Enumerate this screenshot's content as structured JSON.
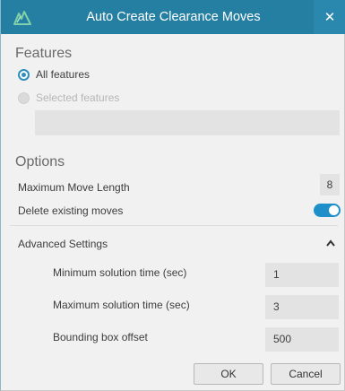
{
  "window": {
    "title": "Auto Create Clearance Moves",
    "app_icon": "dynamics-logo-icon",
    "close_icon": "close-icon",
    "titlebar_color": "#257fa3"
  },
  "features": {
    "title": "Features",
    "all_label": "All features",
    "selected_label": "Selected features",
    "selection": "All features",
    "selection_box_value": ""
  },
  "options": {
    "title": "Options",
    "max_move_length_label": "Maximum Move Length",
    "max_move_length_value": "8",
    "delete_moves_label": "Delete existing moves",
    "delete_moves_on": true,
    "toggle_color": "#1f8fc9"
  },
  "advanced": {
    "title": "Advanced Settings",
    "expanded": true,
    "chevron_icon": "chevron-up-icon",
    "rows": [
      {
        "label": "Minimum solution time (sec)",
        "value": "1"
      },
      {
        "label": "Maximum solution time (sec)",
        "value": "3"
      },
      {
        "label": "Bounding box offset",
        "value": "500"
      }
    ]
  },
  "buttons": {
    "ok": "OK",
    "cancel": "Cancel"
  }
}
